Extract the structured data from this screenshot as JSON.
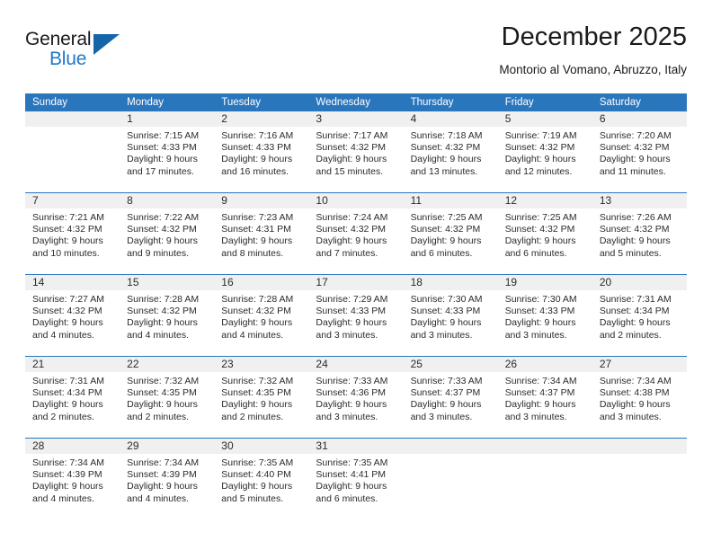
{
  "brand": {
    "name_part1": "General",
    "name_part2": "Blue",
    "logo_icon": "triangle-flag-icon"
  },
  "header": {
    "title": "December 2025",
    "subtitle": "Montorio al Vomano, Abruzzo, Italy"
  },
  "calendar": {
    "weekday_headers": [
      "Sunday",
      "Monday",
      "Tuesday",
      "Wednesday",
      "Thursday",
      "Friday",
      "Saturday"
    ],
    "accent_color": "#2a76bd",
    "daynum_band_color": "#f0f0f0",
    "weeks": [
      [
        {
          "day": "",
          "lines": []
        },
        {
          "day": "1",
          "lines": [
            "Sunrise: 7:15 AM",
            "Sunset: 4:33 PM",
            "Daylight: 9 hours",
            "and 17 minutes."
          ]
        },
        {
          "day": "2",
          "lines": [
            "Sunrise: 7:16 AM",
            "Sunset: 4:33 PM",
            "Daylight: 9 hours",
            "and 16 minutes."
          ]
        },
        {
          "day": "3",
          "lines": [
            "Sunrise: 7:17 AM",
            "Sunset: 4:32 PM",
            "Daylight: 9 hours",
            "and 15 minutes."
          ]
        },
        {
          "day": "4",
          "lines": [
            "Sunrise: 7:18 AM",
            "Sunset: 4:32 PM",
            "Daylight: 9 hours",
            "and 13 minutes."
          ]
        },
        {
          "day": "5",
          "lines": [
            "Sunrise: 7:19 AM",
            "Sunset: 4:32 PM",
            "Daylight: 9 hours",
            "and 12 minutes."
          ]
        },
        {
          "day": "6",
          "lines": [
            "Sunrise: 7:20 AM",
            "Sunset: 4:32 PM",
            "Daylight: 9 hours",
            "and 11 minutes."
          ]
        }
      ],
      [
        {
          "day": "7",
          "lines": [
            "Sunrise: 7:21 AM",
            "Sunset: 4:32 PM",
            "Daylight: 9 hours",
            "and 10 minutes."
          ]
        },
        {
          "day": "8",
          "lines": [
            "Sunrise: 7:22 AM",
            "Sunset: 4:32 PM",
            "Daylight: 9 hours",
            "and 9 minutes."
          ]
        },
        {
          "day": "9",
          "lines": [
            "Sunrise: 7:23 AM",
            "Sunset: 4:31 PM",
            "Daylight: 9 hours",
            "and 8 minutes."
          ]
        },
        {
          "day": "10",
          "lines": [
            "Sunrise: 7:24 AM",
            "Sunset: 4:32 PM",
            "Daylight: 9 hours",
            "and 7 minutes."
          ]
        },
        {
          "day": "11",
          "lines": [
            "Sunrise: 7:25 AM",
            "Sunset: 4:32 PM",
            "Daylight: 9 hours",
            "and 6 minutes."
          ]
        },
        {
          "day": "12",
          "lines": [
            "Sunrise: 7:25 AM",
            "Sunset: 4:32 PM",
            "Daylight: 9 hours",
            "and 6 minutes."
          ]
        },
        {
          "day": "13",
          "lines": [
            "Sunrise: 7:26 AM",
            "Sunset: 4:32 PM",
            "Daylight: 9 hours",
            "and 5 minutes."
          ]
        }
      ],
      [
        {
          "day": "14",
          "lines": [
            "Sunrise: 7:27 AM",
            "Sunset: 4:32 PM",
            "Daylight: 9 hours",
            "and 4 minutes."
          ]
        },
        {
          "day": "15",
          "lines": [
            "Sunrise: 7:28 AM",
            "Sunset: 4:32 PM",
            "Daylight: 9 hours",
            "and 4 minutes."
          ]
        },
        {
          "day": "16",
          "lines": [
            "Sunrise: 7:28 AM",
            "Sunset: 4:32 PM",
            "Daylight: 9 hours",
            "and 4 minutes."
          ]
        },
        {
          "day": "17",
          "lines": [
            "Sunrise: 7:29 AM",
            "Sunset: 4:33 PM",
            "Daylight: 9 hours",
            "and 3 minutes."
          ]
        },
        {
          "day": "18",
          "lines": [
            "Sunrise: 7:30 AM",
            "Sunset: 4:33 PM",
            "Daylight: 9 hours",
            "and 3 minutes."
          ]
        },
        {
          "day": "19",
          "lines": [
            "Sunrise: 7:30 AM",
            "Sunset: 4:33 PM",
            "Daylight: 9 hours",
            "and 3 minutes."
          ]
        },
        {
          "day": "20",
          "lines": [
            "Sunrise: 7:31 AM",
            "Sunset: 4:34 PM",
            "Daylight: 9 hours",
            "and 2 minutes."
          ]
        }
      ],
      [
        {
          "day": "21",
          "lines": [
            "Sunrise: 7:31 AM",
            "Sunset: 4:34 PM",
            "Daylight: 9 hours",
            "and 2 minutes."
          ]
        },
        {
          "day": "22",
          "lines": [
            "Sunrise: 7:32 AM",
            "Sunset: 4:35 PM",
            "Daylight: 9 hours",
            "and 2 minutes."
          ]
        },
        {
          "day": "23",
          "lines": [
            "Sunrise: 7:32 AM",
            "Sunset: 4:35 PM",
            "Daylight: 9 hours",
            "and 2 minutes."
          ]
        },
        {
          "day": "24",
          "lines": [
            "Sunrise: 7:33 AM",
            "Sunset: 4:36 PM",
            "Daylight: 9 hours",
            "and 3 minutes."
          ]
        },
        {
          "day": "25",
          "lines": [
            "Sunrise: 7:33 AM",
            "Sunset: 4:37 PM",
            "Daylight: 9 hours",
            "and 3 minutes."
          ]
        },
        {
          "day": "26",
          "lines": [
            "Sunrise: 7:34 AM",
            "Sunset: 4:37 PM",
            "Daylight: 9 hours",
            "and 3 minutes."
          ]
        },
        {
          "day": "27",
          "lines": [
            "Sunrise: 7:34 AM",
            "Sunset: 4:38 PM",
            "Daylight: 9 hours",
            "and 3 minutes."
          ]
        }
      ],
      [
        {
          "day": "28",
          "lines": [
            "Sunrise: 7:34 AM",
            "Sunset: 4:39 PM",
            "Daylight: 9 hours",
            "and 4 minutes."
          ]
        },
        {
          "day": "29",
          "lines": [
            "Sunrise: 7:34 AM",
            "Sunset: 4:39 PM",
            "Daylight: 9 hours",
            "and 4 minutes."
          ]
        },
        {
          "day": "30",
          "lines": [
            "Sunrise: 7:35 AM",
            "Sunset: 4:40 PM",
            "Daylight: 9 hours",
            "and 5 minutes."
          ]
        },
        {
          "day": "31",
          "lines": [
            "Sunrise: 7:35 AM",
            "Sunset: 4:41 PM",
            "Daylight: 9 hours",
            "and 6 minutes."
          ]
        },
        {
          "day": "",
          "lines": []
        },
        {
          "day": "",
          "lines": []
        },
        {
          "day": "",
          "lines": []
        }
      ]
    ]
  }
}
